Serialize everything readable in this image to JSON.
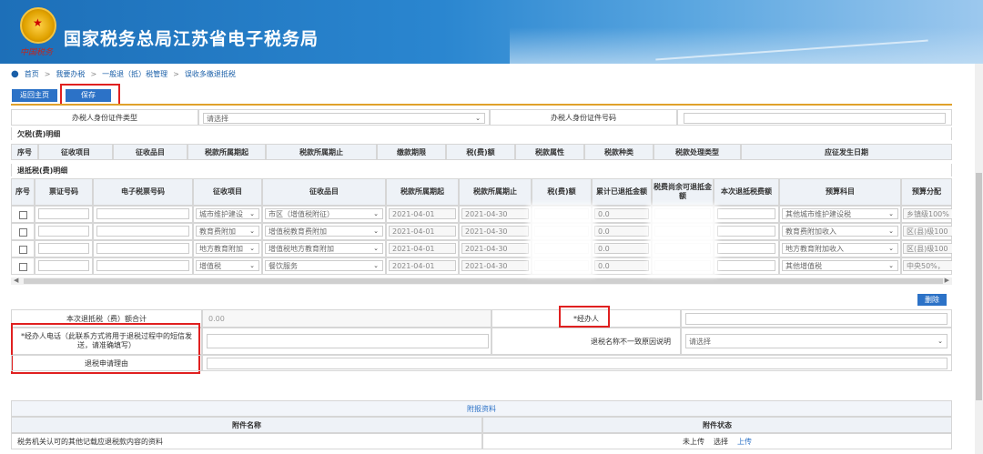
{
  "header": {
    "site_title": "国家税务总局江苏省电子税务局",
    "logo_script": "中国税务",
    "accent": "#1d6fb8"
  },
  "breadcrumb": {
    "items": [
      "首页",
      "我要办税",
      "一般退（抵）税管理",
      "误收多缴退抵税"
    ],
    "sep": ">"
  },
  "toolbar": {
    "back_label": "返回主页",
    "save_label": "保存"
  },
  "id_row": {
    "id_type_label": "办税人身份证件类型",
    "id_type_value": "请选择",
    "id_no_label": "办税人身份证件号码"
  },
  "owed": {
    "title": "欠税(费)明细",
    "columns": [
      "序号",
      "征收项目",
      "征收品目",
      "税款所属期起",
      "税款所属期止",
      "缴款期限",
      "税(费)额",
      "税款属性",
      "税款种类",
      "税款处理类型",
      "应征发生日期"
    ]
  },
  "refund": {
    "title": "退抵税(费)明细",
    "columns": [
      "序号",
      "票证号码",
      "电子税票号码",
      "征收项目",
      "征收品目",
      "税款所属期起",
      "税款所属期止",
      "税(费)额",
      "累计已退抵金额",
      "税费尚余可退抵金额",
      "本次退抵税费额",
      "预算科目",
      "预算分配"
    ],
    "rows": [
      {
        "item": "城市维护建设",
        "subitem": "市区（增值税附征）",
        "start": "2021-04-01",
        "end": "2021-04-30",
        "refunded": "0.0",
        "budget": "其他城市维护建设税",
        "alloc": "乡镇级100%"
      },
      {
        "item": "教育费附加",
        "subitem": "增值税教育费附加",
        "start": "2021-04-01",
        "end": "2021-04-30",
        "refunded": "0.0",
        "budget": "教育费附加收入",
        "alloc": "区(县)级100"
      },
      {
        "item": "地方教育附加",
        "subitem": "增值税地方教育附加",
        "start": "2021-04-01",
        "end": "2021-04-30",
        "refunded": "0.0",
        "budget": "地方教育附加收入",
        "alloc": "区(县)级100"
      },
      {
        "item": "增值税",
        "subitem": "餐饮服务",
        "start": "2021-04-01",
        "end": "2021-04-30",
        "refunded": "0.0",
        "budget": "其他增值税",
        "alloc": "中央50%，"
      }
    ],
    "delete_label": "删除"
  },
  "form": {
    "total_label": "本次退抵税（费）额合计",
    "total_value": "0.00",
    "handler_label": "*经办人",
    "phone_label": "*经办人电话（此联系方式将用于退税过程中的短信发送，请准确填写）",
    "reason_label": "退税名称不一致原因说明",
    "reason_value": "请选择",
    "reason_apply_label": "退税申请理由"
  },
  "attachments": {
    "title": "附报资料",
    "col_name": "附件名称",
    "col_status": "附件状态",
    "row_name": "税务机关认可的其他记载应退税款内容的资料",
    "row_status": "未上传",
    "row_select": "选择",
    "row_upload": "上传"
  },
  "colors": {
    "button": "#2c72c7",
    "highlight": "#e02020",
    "gold": "#e0a12a",
    "header_bg": "#eef2f7"
  }
}
